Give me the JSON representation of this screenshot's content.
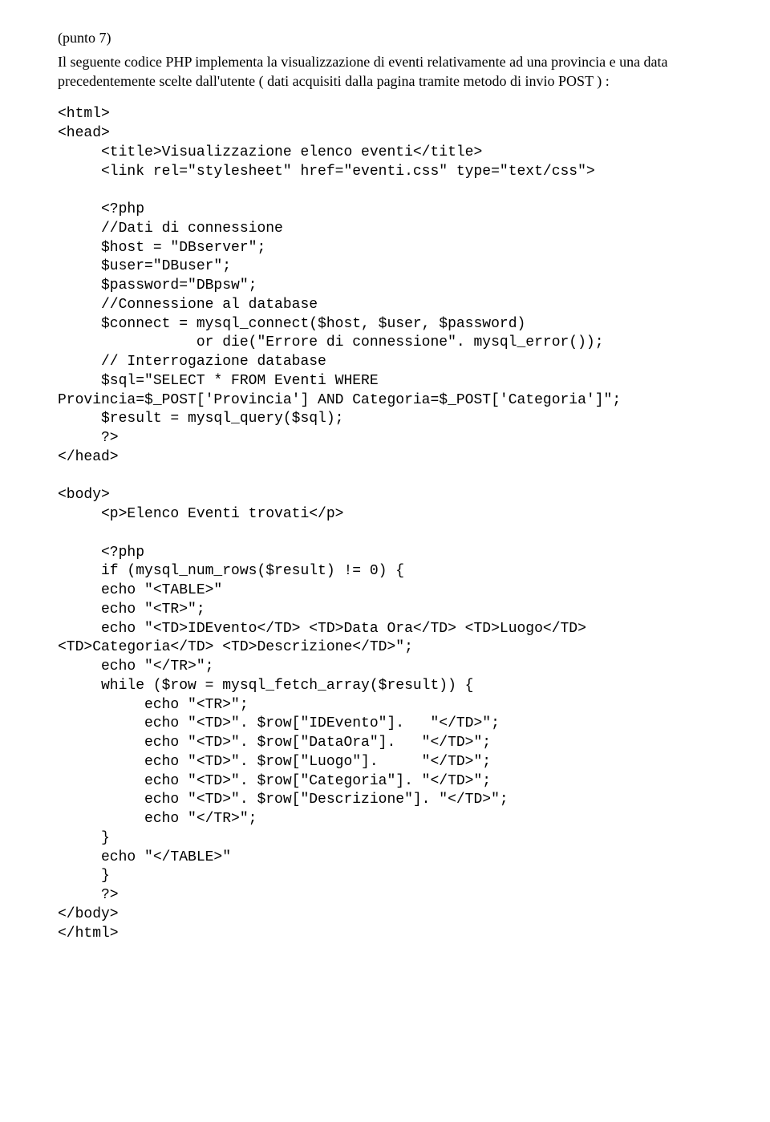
{
  "intro": {
    "line1": "(punto 7)",
    "line2": "Il seguente codice PHP implementa la visualizzazione di eventi relativamente ad una provincia e una data precedentemente scelte dall'utente ( dati acquisiti dalla pagina tramite metodo di invio POST ) :"
  },
  "code": "<html>\n<head>\n     <title>Visualizzazione elenco eventi</title>\n     <link rel=\"stylesheet\" href=\"eventi.css\" type=\"text/css\">\n\n     <?php\n     //Dati di connessione\n     $host = \"DBserver\";\n     $user=\"DBuser\";\n     $password=\"DBpsw\";\n     //Connessione al database\n     $connect = mysql_connect($host, $user, $password)\n                or die(\"Errore di connessione\". mysql_error());\n     // Interrogazione database\n     $sql=\"SELECT * FROM Eventi WHERE\nProvincia=$_POST['Provincia'] AND Categoria=$_POST['Categoria']\";\n     $result = mysql_query($sql);\n     ?>\n</head>\n\n<body>\n     <p>Elenco Eventi trovati</p>\n\n     <?php\n     if (mysql_num_rows($result) != 0) {\n     echo \"<TABLE>\"\n     echo \"<TR>\";\n     echo \"<TD>IDEvento</TD> <TD>Data Ora</TD> <TD>Luogo</TD>\n<TD>Categoria</TD> <TD>Descrizione</TD>\";\n     echo \"</TR>\";\n     while ($row = mysql_fetch_array($result)) {\n          echo \"<TR>\";\n          echo \"<TD>\". $row[\"IDEvento\"].   \"</TD>\";\n          echo \"<TD>\". $row[\"DataOra\"].   \"</TD>\";\n          echo \"<TD>\". $row[\"Luogo\"].     \"</TD>\";\n          echo \"<TD>\". $row[\"Categoria\"]. \"</TD>\";\n          echo \"<TD>\". $row[\"Descrizione\"]. \"</TD>\";\n          echo \"</TR>\";\n     }\n     echo \"</TABLE>\"\n     }\n     ?>\n</body>\n</html>"
}
